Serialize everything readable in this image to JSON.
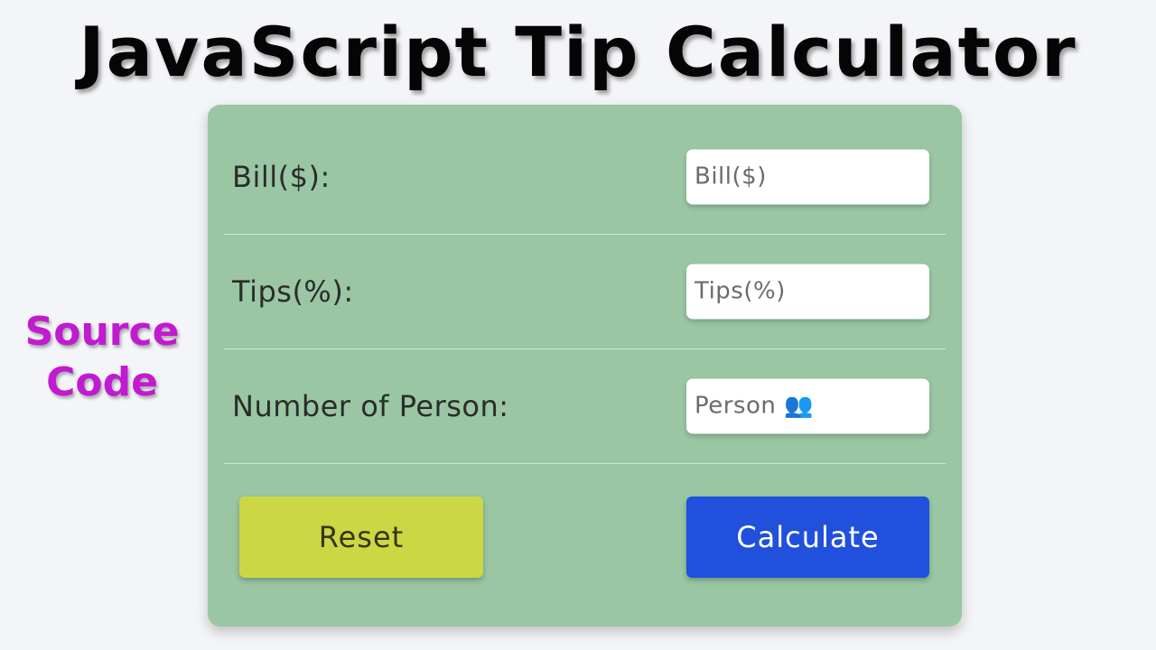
{
  "title": "JavaScript Tip Calculator",
  "side_label": {
    "line1": "Source",
    "line2": "Code"
  },
  "form": {
    "bill": {
      "label": "Bill($):",
      "placeholder": "Bill($)",
      "value": ""
    },
    "tips": {
      "label": "Tips(%):",
      "placeholder": "Tips(%)",
      "value": ""
    },
    "person": {
      "label": "Number of Person:",
      "placeholder": "Person 👥",
      "value": ""
    }
  },
  "buttons": {
    "reset_label": "Reset",
    "calculate_label": "Calculate"
  },
  "colors": {
    "card_background": "#9ac6a3",
    "reset_button": "#cbd844",
    "calculate_button": "#2150dc",
    "side_label": "#c21ad0"
  }
}
